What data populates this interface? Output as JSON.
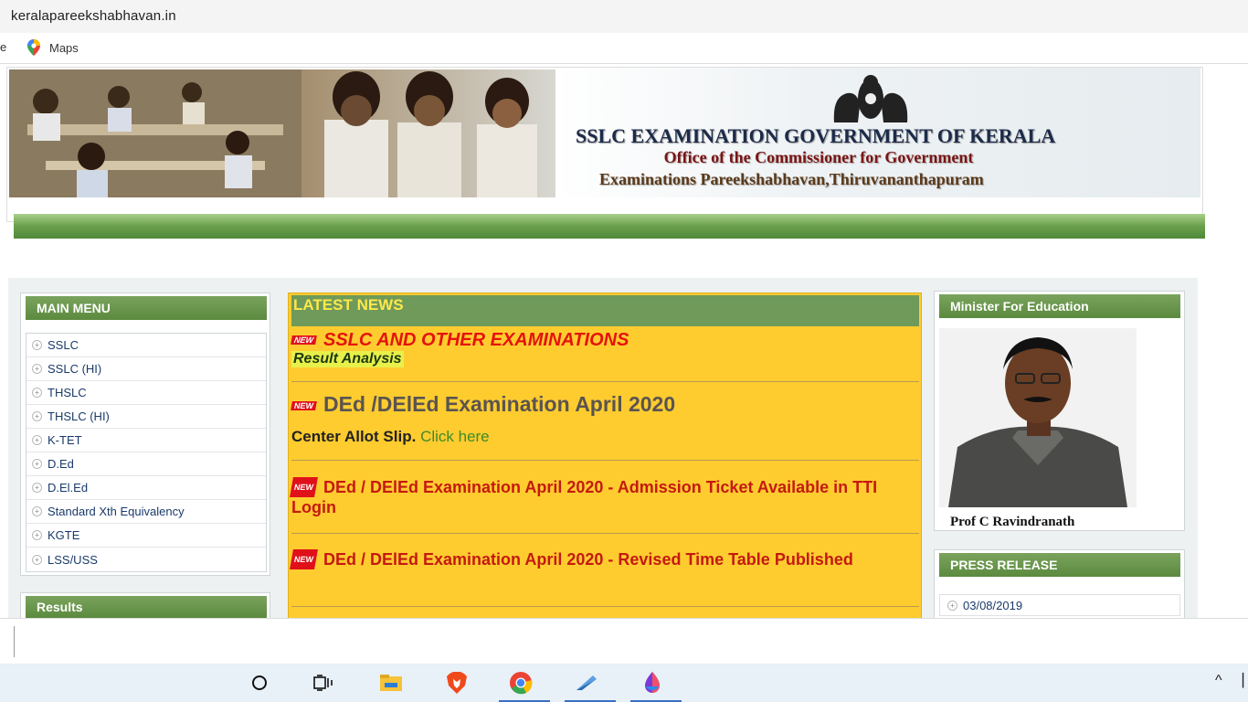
{
  "browser": {
    "url": "keralapareekshabhavan.in",
    "bookmark_trunc": "e",
    "bookmarks": [
      {
        "label": "Maps"
      }
    ]
  },
  "banner": {
    "title": "SSLC EXAMINATION GOVERNMENT OF KERALA",
    "line2": "Office of the Commissioner for Government",
    "line3": "Examinations Pareekshabhavan,Thiruvananthapuram"
  },
  "main_menu": {
    "title": "MAIN MENU",
    "items": [
      {
        "label": "SSLC"
      },
      {
        "label": "SSLC (HI)"
      },
      {
        "label": "THSLC"
      },
      {
        "label": "THSLC (HI)"
      },
      {
        "label": "K-TET"
      },
      {
        "label": "D.Ed"
      },
      {
        "label": "D.El.Ed"
      },
      {
        "label": "Standard Xth Equivalency"
      },
      {
        "label": "KGTE"
      },
      {
        "label": "LSS/USS"
      }
    ]
  },
  "results": {
    "title": "Results"
  },
  "news": {
    "title": "LATEST NEWS",
    "new_badge": "NEW",
    "items": [
      {
        "title": "SSLC AND OTHER EXAMINATIONS",
        "subtitle": "Result Analysis"
      },
      {
        "title": "DEd /DElEd Examination April 2020",
        "subtitle": "Center Allot Slip.",
        "link": "Click here"
      },
      {
        "title": "DEd / DElEd Examination April 2020 - Admission Ticket Available in TTI Login"
      },
      {
        "title": "DEd / DElEd Examination April 2020 - Revised Time Table Published"
      }
    ]
  },
  "minister": {
    "title": "Minister For Education",
    "name": "Prof C Ravindranath"
  },
  "press": {
    "title": "PRESS RELEASE",
    "items": [
      {
        "date": "03/08/2019"
      }
    ]
  },
  "taskbar": {
    "apps": [
      "cortana-icon",
      "task-view-icon",
      "file-explorer-icon",
      "brave-icon",
      "chrome-icon",
      "snip-icon",
      "paint3d-icon"
    ]
  }
}
